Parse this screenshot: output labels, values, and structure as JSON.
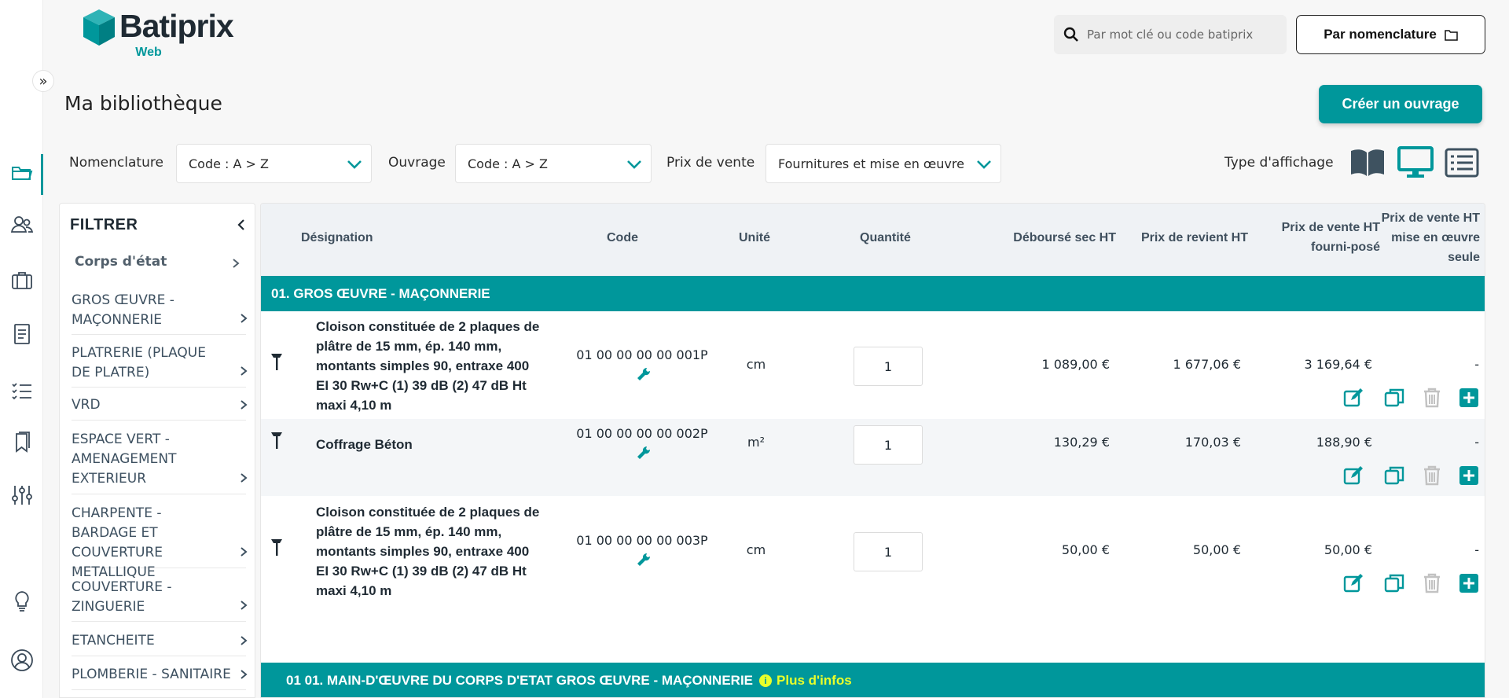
{
  "app": {
    "logo_name": "Batiprix",
    "logo_sub": "Web"
  },
  "header": {
    "search_placeholder": "Par mot clé ou code batiprix",
    "nomenclature_button": "Par nomenclature"
  },
  "page": {
    "title": "Ma bibliothèque",
    "create_button": "Créer un ouvrage"
  },
  "filters": {
    "nomenclature_label": "Nomenclature",
    "nomenclature_value": "Code : A > Z",
    "ouvrage_label": "Ouvrage",
    "ouvrage_value": "Code : A > Z",
    "prix_label": "Prix de vente",
    "prix_value": "Fournitures et mise en œuvre",
    "view_label": "Type d'affichage"
  },
  "sidebar": {
    "title": "FILTRER",
    "head": "Corps d'état",
    "items": [
      "GROS ŒUVRE - MAÇONNERIE",
      "PLATRERIE (PLAQUE DE PLATRE)",
      "VRD",
      "ESPACE VERT - AMENAGEMENT EXTERIEUR",
      "CHARPENTE - BARDAGE ET COUVERTURE METALLIQUE",
      "COUVERTURE - ZINGUERIE",
      "ETANCHEITE",
      "PLOMBERIE - SANITAIRE"
    ]
  },
  "table": {
    "columns": {
      "designation": "Désignation",
      "code": "Code",
      "unite": "Unité",
      "quantite": "Quantité",
      "debourse": "Déboursé sec HT",
      "revient": "Prix de revient HT",
      "vente_fp_1": "Prix de vente HT",
      "vente_fp_2": "fourni-posé",
      "vente_mo_1": "Prix de vente HT",
      "vente_mo_2": "mise en œuvre",
      "vente_mo_3": "seule"
    },
    "group1": "01. GROS ŒUVRE - MAÇONNERIE",
    "group2": "01 01. MAIN-D'ŒUVRE DU CORPS D'ETAT GROS ŒUVRE - MAÇONNERIE",
    "group2_more": "Plus d'infos",
    "rows": [
      {
        "designation_lines": [
          "Cloison constituée de 2 plaques de",
          "plâtre de 15 mm, ép. 140 mm,",
          "montants simples 90, entraxe 400",
          "EI 30 Rw+C (1) 39 dB (2) 47 dB Ht",
          "maxi 4,10 m"
        ],
        "code": "01 00 00 00 00 001P",
        "unite": "cm",
        "quantite": "1",
        "debourse": "1 089,00 €",
        "revient": "1 677,06 €",
        "vente_fp": "3 169,64 €",
        "vente_mo": "-"
      },
      {
        "designation_lines": [
          "Coffrage Béton"
        ],
        "code": "01 00 00 00 00 002P",
        "unite": "m²",
        "quantite": "1",
        "debourse": "130,29 €",
        "revient": "170,03 €",
        "vente_fp": "188,90 €",
        "vente_mo": "-"
      },
      {
        "designation_lines": [
          "Cloison constituée de 2 plaques de",
          "plâtre de 15 mm, ép. 140 mm,",
          "montants simples 90, entraxe 400",
          "EI 30 Rw+C (1) 39 dB (2) 47 dB Ht",
          "maxi 4,10 m"
        ],
        "code": "01 00 00 00 00 003P",
        "unite": "cm",
        "quantite": "1",
        "debourse": "50,00 €",
        "revient": "50,00 €",
        "vente_fp": "50,00 €",
        "vente_mo": "-"
      }
    ]
  },
  "colors": {
    "accent": "#00979b",
    "text_dark": "#1f2a33",
    "highlight": "#e9ff2a"
  }
}
